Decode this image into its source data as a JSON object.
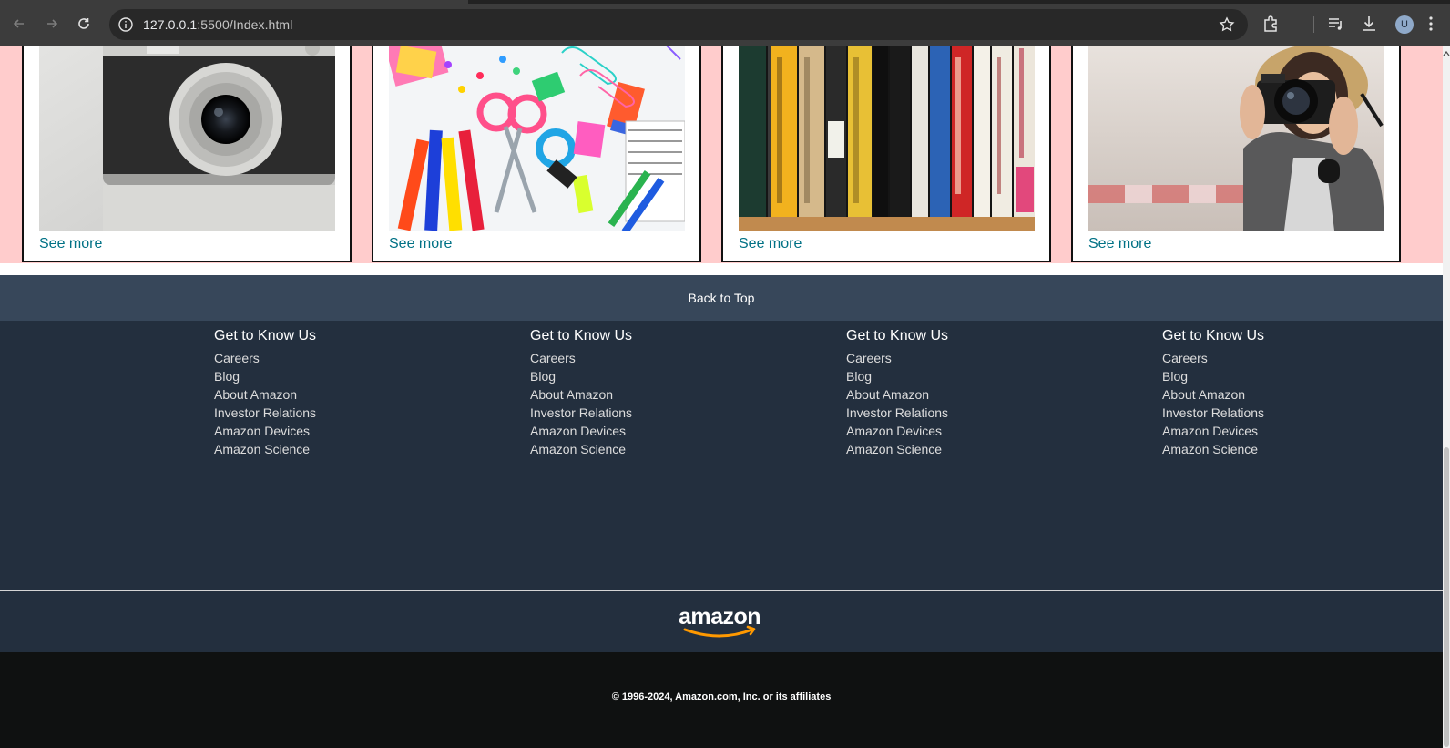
{
  "browser": {
    "url_host": "127.0.0.1",
    "url_rest": ":5500/Index.html",
    "avatar_letter": "U"
  },
  "products": {
    "cards": [
      {
        "link": "See more",
        "image": "vintage-camera"
      },
      {
        "link": "See more",
        "image": "school-supplies"
      },
      {
        "link": "See more",
        "image": "books-shelf"
      },
      {
        "link": "See more",
        "image": "woman-with-camera"
      }
    ]
  },
  "back_to_top": "Back to Top",
  "footer": {
    "columns": [
      {
        "heading": "Get to Know Us",
        "links": [
          "Careers",
          "Blog",
          "About Amazon",
          "Investor Relations",
          "Amazon Devices",
          "Amazon Science"
        ]
      },
      {
        "heading": "Get to Know Us",
        "links": [
          "Careers",
          "Blog",
          "About Amazon",
          "Investor Relations",
          "Amazon Devices",
          "Amazon Science"
        ]
      },
      {
        "heading": "Get to Know Us",
        "links": [
          "Careers",
          "Blog",
          "About Amazon",
          "Investor Relations",
          "Amazon Devices",
          "Amazon Science"
        ]
      },
      {
        "heading": "Get to Know Us",
        "links": [
          "Careers",
          "Blog",
          "About Amazon",
          "Investor Relations",
          "Amazon Devices",
          "Amazon Science"
        ]
      }
    ],
    "logo_text": "amazon",
    "copyright": "© 1996-2024, Amazon.com, Inc. or its affiliates"
  },
  "colors": {
    "link": "#007185",
    "products_bg": "#ffcccc",
    "back_to_top_bg": "#37475a",
    "footer_bg": "#232f3e",
    "bottom_bg": "#0f1111",
    "logo_smile": "#ff9900"
  }
}
